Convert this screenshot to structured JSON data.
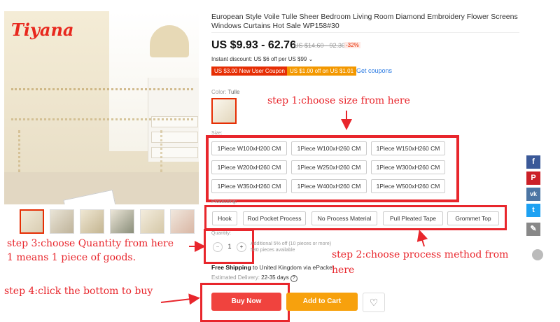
{
  "brand": {
    "logo_text": "Tiyana"
  },
  "product": {
    "title": "European Style Voile Tulle Sheer Bedroom Living Room Diamond Embroidery Flower Screens Windows Curtains Hot Sale WP158#30",
    "price": "US $9.93 - 62.76",
    "old_price": "US $14.60 - 92.30",
    "discount": "-32%",
    "instant_discount": "Instant discount: US $6 off per US $99 ⌄",
    "coupons": [
      "US $3.00 New User Coupon",
      "US $1.00 off on US $1.01"
    ],
    "get_coupons": "Get coupons",
    "color_label": "Color:",
    "color_value": "Tulle",
    "size_label": "Size:",
    "sizes": [
      "1Piece W100xH200 CM",
      "1Piece W100xH260 CM",
      "1Piece W150xH260 CM",
      "1Piece W200xH260 CM",
      "1Piece W250xH260 CM",
      "1Piece W300xH260 CM",
      "1Piece W350xH260 CM",
      "1Piece W400xH260 CM",
      "1Piece W500xH260 CM"
    ],
    "processing_label": "Processing:",
    "processing": [
      "Hook",
      "Rod Pocket Process",
      "No Process Material",
      "Pull Pleated Tape",
      "Grommet Top"
    ],
    "quantity_label": "Quantity:",
    "quantity": "1",
    "qty_minus": "−",
    "qty_plus": "+",
    "qty_note_1": "Additional 5% off (10 pieces or more)",
    "qty_note_2": "580 pieces available",
    "shipping_bold": "Free Shipping",
    "shipping_rest": " to United Kingdom via ePacket",
    "estimated_label": "Estimated Delivery: ",
    "estimated_value": "22-35 days",
    "info_glyph": "?",
    "buy_now": "Buy Now",
    "add_to_cart": "Add to Cart",
    "wishlist_glyph": "♡"
  },
  "social": [
    {
      "icon": "facebook-icon",
      "glyph": "f",
      "color": "#3b5998"
    },
    {
      "icon": "pinterest-icon",
      "glyph": "P",
      "color": "#cb2027"
    },
    {
      "icon": "vk-icon",
      "glyph": "vk",
      "color": "#4c75a3"
    },
    {
      "icon": "twitter-icon",
      "glyph": "t",
      "color": "#1da1f2"
    },
    {
      "icon": "pencil-icon",
      "glyph": "✎",
      "color": "#888888"
    }
  ],
  "annotations": {
    "step1": "step 1:choose size from here",
    "step2_a": "step 2:choose process method from",
    "step2_b": "here",
    "step3_a": "step 3:choose Quantity from here",
    "step3_b": "1 means 1 piece of goods.",
    "step4": "step 4:click the bottom to buy"
  },
  "colors": {
    "accent": "#e62e04",
    "annotation_red": "#e8262c",
    "buy": "#f0433e",
    "cart": "#f7a10d"
  }
}
